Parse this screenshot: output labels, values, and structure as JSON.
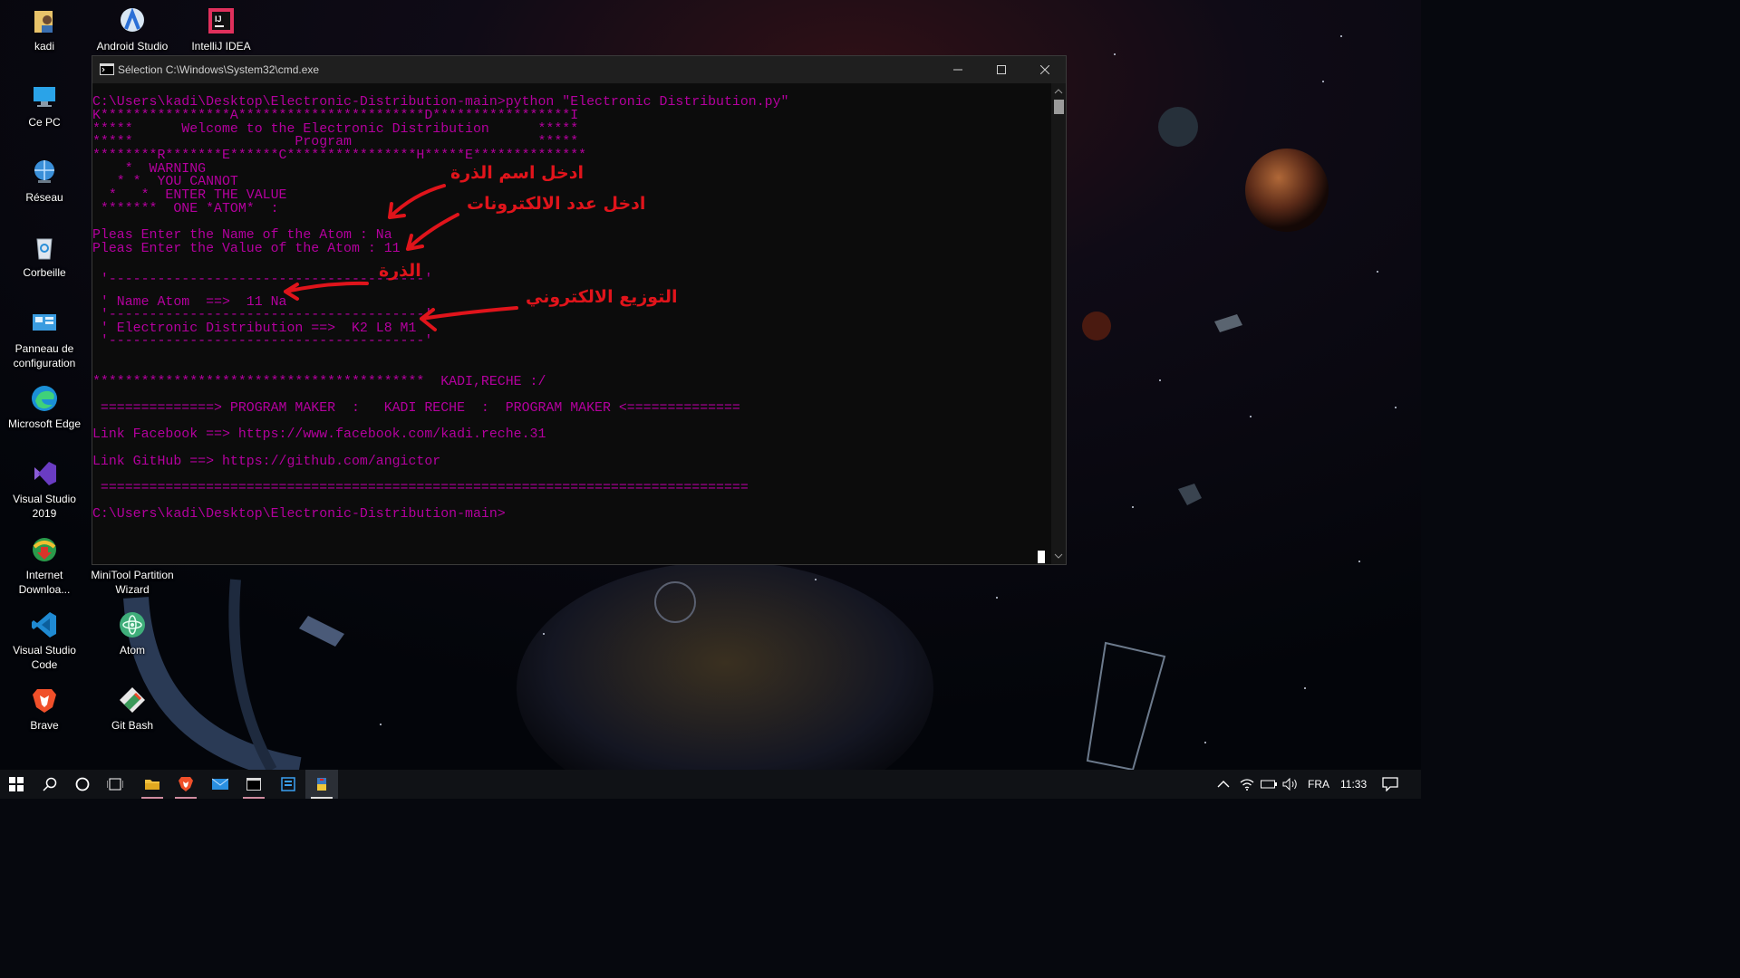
{
  "desktop": {
    "icons": [
      {
        "label": "kadi",
        "icon": "user-folder-icon"
      },
      {
        "label": "Android Studio",
        "icon": "android-studio-icon"
      },
      {
        "label": "IntelliJ IDEA",
        "icon": "intellij-idea-icon"
      },
      {
        "label": "Ce PC",
        "icon": "this-pc-icon"
      },
      {
        "label": "Réseau",
        "icon": "network-icon"
      },
      {
        "label": "Corbeille",
        "icon": "recycle-bin-icon"
      },
      {
        "label": "Panneau de configuration",
        "icon": "control-panel-icon"
      },
      {
        "label": "Microsoft Edge",
        "icon": "edge-icon"
      },
      {
        "label": "Visual Studio 2019",
        "icon": "visual-studio-icon"
      },
      {
        "label": "Internet Downloa...",
        "icon": "internet-download-manager-icon"
      },
      {
        "label": "MiniTool Partition Wizard",
        "icon": "minitool-icon"
      },
      {
        "label": "Visual Studio Code",
        "icon": "vscode-icon"
      },
      {
        "label": "Atom",
        "icon": "atom-icon"
      },
      {
        "label": "Brave",
        "icon": "brave-icon"
      },
      {
        "label": "Git Bash",
        "icon": "git-bash-icon"
      }
    ]
  },
  "cmd": {
    "title": "Sélection C:\\Windows\\System32\\cmd.exe",
    "text_color": "#b4009e",
    "lines": [
      "C:\\Users\\kadi\\Desktop\\Electronic-Distribution-main>python \"Electronic Distribution.py\"",
      "K****************A***********************D*****************I",
      "*****      Welcome to the Electronic Distribution      *****",
      "*****                    Program                       *****",
      "********R*******E******C****************H*****E**************",
      "    *  WARNING",
      "   * *  YOU CANNOT",
      "  *   *  ENTER THE VALUE",
      " *******  ONE *ATOM*  :",
      "",
      "Pleas Enter the Name of the Atom : Na",
      "Pleas Enter the Value of the Atom : 11",
      "",
      " '---------------------------------------'",
      " ' Name Atom  ==>  11 Na",
      " '---------------------------------------'",
      " ' Electronic Distribution ==>  K2 L8 M1",
      " '---------------------------------------'",
      "",
      "",
      "*****************************************  KADI,RECHE :/",
      "",
      " ==============> PROGRAM MAKER  :   KADI RECHE  :  PROGRAM MAKER <==============",
      "",
      "Link Facebook ==> https://www.facebook.com/kadi.reche.31",
      "",
      "Link GitHub ==> https://github.com/angictor",
      "",
      " ================================================================================",
      "",
      "C:\\Users\\kadi\\Desktop\\Electronic-Distribution-main>"
    ]
  },
  "annotations": {
    "color": "#e0141b",
    "enter_atom_name": "ادخل اسم الذرة",
    "enter_electron_count": "ادخل عدد الالكترونات",
    "atom": "الذرة",
    "electronic_distribution": "التوزيع الالكتروني"
  },
  "taskbar": {
    "buttons": [
      "start-icon",
      "search-icon",
      "cortana-icon",
      "task-view-icon",
      "file-explorer-icon",
      "brave-icon",
      "mail-icon",
      "cmd-icon",
      "app-icon",
      "python-icon"
    ],
    "language": "FRA",
    "time": "11:33"
  }
}
